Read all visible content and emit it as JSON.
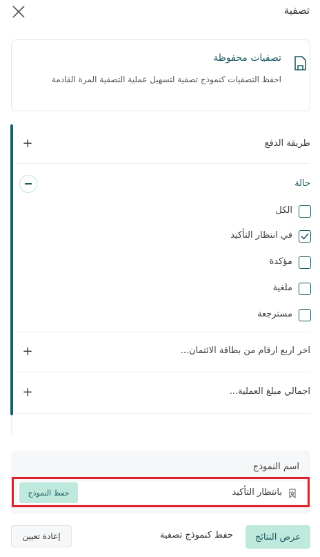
{
  "header": {
    "title": "تصفية"
  },
  "saved_filters": {
    "title": "تصفيات محفوظة",
    "description": "احفظ التصفيات كنموذج تصفية لتسهيل عملية التصفية المرة القادمة"
  },
  "sections": {
    "payment_method": {
      "label": "طريقة الدفع"
    },
    "status": {
      "label": "حالة",
      "options": [
        {
          "label": "الكل",
          "checked": false
        },
        {
          "label": "في انتظار التأكيد",
          "checked": true
        },
        {
          "label": "مؤكدة",
          "checked": false
        },
        {
          "label": "ملغية",
          "checked": false
        },
        {
          "label": "مسترجعة",
          "checked": false
        }
      ]
    },
    "card_last_four": {
      "label": "اخر اربع ارقام من بطاقة الائتمان..."
    },
    "total_amount": {
      "label": "اجمالي مبلغ العملية..."
    }
  },
  "template": {
    "label": "اسم النموذج",
    "value": "بانتظار التأكيد",
    "save_button": "حفظ النموذج"
  },
  "footer": {
    "reset": "إعادة تعيين",
    "save_as_template": "حفظ كنموذج تصفية",
    "show_results": "عرض النتائج"
  },
  "colors": {
    "accent": "#1f5c66",
    "mint": "#bfe9dd",
    "highlight": "#e0202a"
  }
}
